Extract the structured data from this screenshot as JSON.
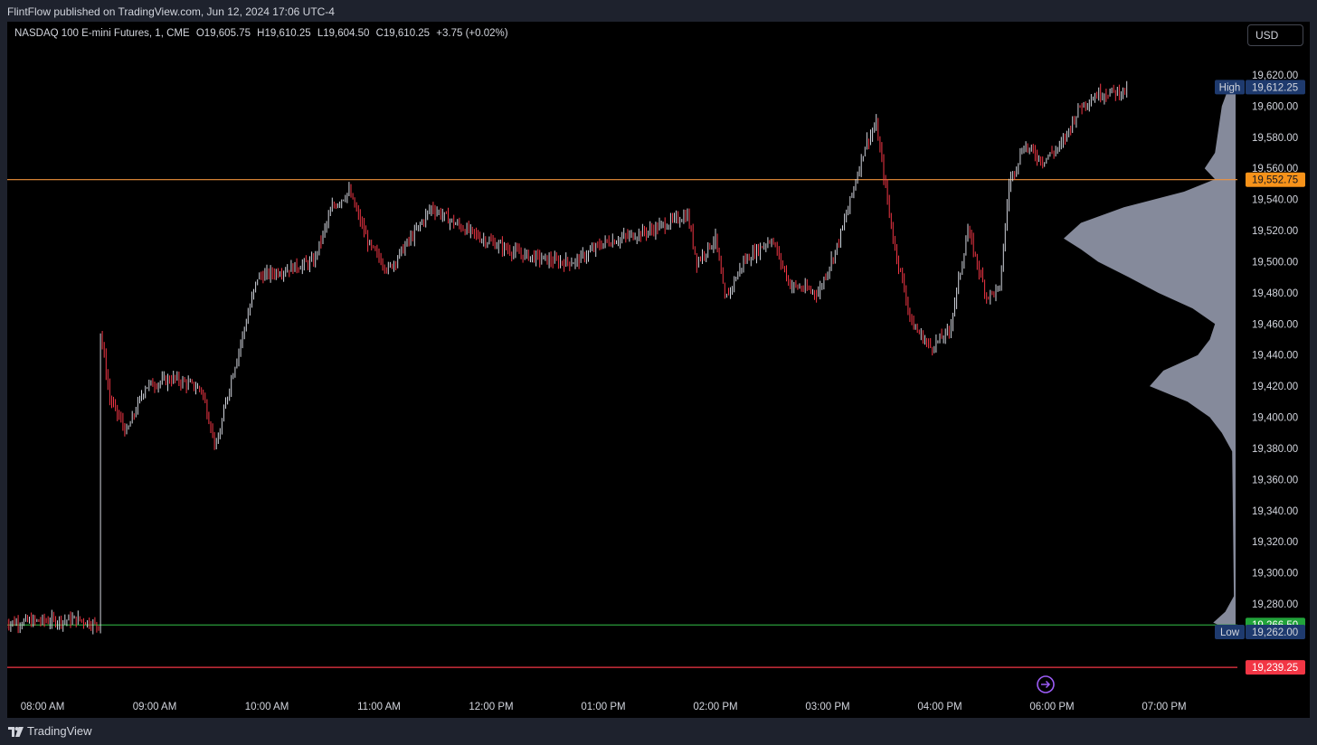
{
  "header": {
    "published_by": "FlintFlow published on TradingView.com, Jun 12, 2024 17:06 UTC-4"
  },
  "legend": {
    "symbol": "NASDAQ 100 E-mini Futures, 1, CME",
    "open": "O19,605.75",
    "high": "H19,610.25",
    "low": "L19,604.50",
    "close": "C19,610.25",
    "change": "+3.75 (+0.02%)"
  },
  "currency_button": {
    "label": "USD"
  },
  "footer": {
    "brand": "TradingView"
  },
  "colors": {
    "up": "#d1d4dc",
    "down": "#f23645",
    "profile": "#8c91a3",
    "orange_line": "#f0923c",
    "green_line": "#2a9d3a",
    "red_line": "#f23645",
    "high_low_tag": "#1e3a6e",
    "orange_tag": "#f7931a",
    "green_tag": "#22a33a",
    "red_tag": "#f23645"
  },
  "chart_data": {
    "type": "candlestick",
    "timeframe": "1",
    "x_ticks": [
      "08:00 AM",
      "09:00 AM",
      "10:00 AM",
      "11:00 AM",
      "12:00 PM",
      "01:00 PM",
      "02:00 PM",
      "03:00 PM",
      "04:00 PM",
      "06:00 PM",
      "07:00 PM"
    ],
    "y_ticks": [
      19620,
      19600,
      19580,
      19560,
      19540,
      19520,
      19500,
      19480,
      19460,
      19440,
      19420,
      19400,
      19380,
      19360,
      19340,
      19320,
      19300,
      19280
    ],
    "y_tick_labels": [
      "19,620.00",
      "19,600.00",
      "19,580.00",
      "19,560.00",
      "19,540.00",
      "19,520.00",
      "19,500.00",
      "19,480.00",
      "19,460.00",
      "19,440.00",
      "19,420.00",
      "19,400.00",
      "19,380.00",
      "19,360.00",
      "19,340.00",
      "19,320.00",
      "19,300.00",
      "19,280.00"
    ],
    "ylim": [
      19232,
      19640
    ],
    "price_path": [
      [
        "07:40",
        19268
      ],
      [
        "08:20",
        19270
      ],
      [
        "08:30",
        19266
      ],
      [
        "08:31",
        19455
      ],
      [
        "08:36",
        19412
      ],
      [
        "08:45",
        19390
      ],
      [
        "08:55",
        19420
      ],
      [
        "09:10",
        19425
      ],
      [
        "09:25",
        19418
      ],
      [
        "09:33",
        19380
      ],
      [
        "09:40",
        19420
      ],
      [
        "09:55",
        19490
      ],
      [
        "10:25",
        19500
      ],
      [
        "10:35",
        19535
      ],
      [
        "10:44",
        19545
      ],
      [
        "10:55",
        19510
      ],
      [
        "11:05",
        19495
      ],
      [
        "11:20",
        19520
      ],
      [
        "11:28",
        19535
      ],
      [
        "11:40",
        19525
      ],
      [
        "11:55",
        19515
      ],
      [
        "12:15",
        19505
      ],
      [
        "12:35",
        19500
      ],
      [
        "12:45",
        19500
      ],
      [
        "13:00",
        19512
      ],
      [
        "13:25",
        19520
      ],
      [
        "13:45",
        19530
      ],
      [
        "13:50",
        19500
      ],
      [
        "14:00",
        19515
      ],
      [
        "14:05",
        19475
      ],
      [
        "14:15",
        19500
      ],
      [
        "14:30",
        19515
      ],
      [
        "14:40",
        19485
      ],
      [
        "14:55",
        19480
      ],
      [
        "15:05",
        19510
      ],
      [
        "15:10",
        19530
      ],
      [
        "15:20",
        19575
      ],
      [
        "15:26",
        19588
      ],
      [
        "15:35",
        19515
      ],
      [
        "15:45",
        19460
      ],
      [
        "15:55",
        19445
      ],
      [
        "16:05",
        19455
      ],
      [
        "16:15",
        19520
      ],
      [
        "16:25",
        19478
      ],
      [
        "16:32",
        19482
      ],
      [
        "16:37",
        19550
      ],
      [
        "16:45",
        19575
      ],
      [
        "16:55",
        19565
      ],
      [
        "17:05",
        19575
      ],
      [
        "17:15",
        19600
      ],
      [
        "17:25",
        19608
      ],
      [
        "17:40",
        19610
      ]
    ],
    "profile": [
      [
        19612,
        0.04
      ],
      [
        19600,
        0.08
      ],
      [
        19585,
        0.1
      ],
      [
        19570,
        0.12
      ],
      [
        19560,
        0.18
      ],
      [
        19553,
        0.12
      ],
      [
        19545,
        0.3
      ],
      [
        19535,
        0.65
      ],
      [
        19525,
        0.9
      ],
      [
        19515,
        1.0
      ],
      [
        19508,
        0.9
      ],
      [
        19500,
        0.8
      ],
      [
        19490,
        0.62
      ],
      [
        19480,
        0.45
      ],
      [
        19470,
        0.25
      ],
      [
        19460,
        0.12
      ],
      [
        19450,
        0.15
      ],
      [
        19440,
        0.22
      ],
      [
        19430,
        0.42
      ],
      [
        19420,
        0.5
      ],
      [
        19410,
        0.28
      ],
      [
        19400,
        0.15
      ],
      [
        19390,
        0.08
      ],
      [
        19378,
        0.02
      ],
      [
        19285,
        0.01
      ],
      [
        19275,
        0.06
      ],
      [
        19268,
        0.13
      ],
      [
        19264,
        0.05
      ]
    ],
    "levels": [
      {
        "name": "orange",
        "price": 19552.75,
        "label": "19,552.75"
      },
      {
        "name": "green",
        "price": 19266.5,
        "label": "19,266.50"
      },
      {
        "name": "red",
        "price": 19239.25,
        "label": "19,239.25"
      }
    ],
    "high": {
      "tag": "High",
      "price": 19612.25,
      "label": "19,612.25"
    },
    "low": {
      "tag": "Low",
      "price": 19262.0,
      "label": "19,262.00"
    }
  }
}
